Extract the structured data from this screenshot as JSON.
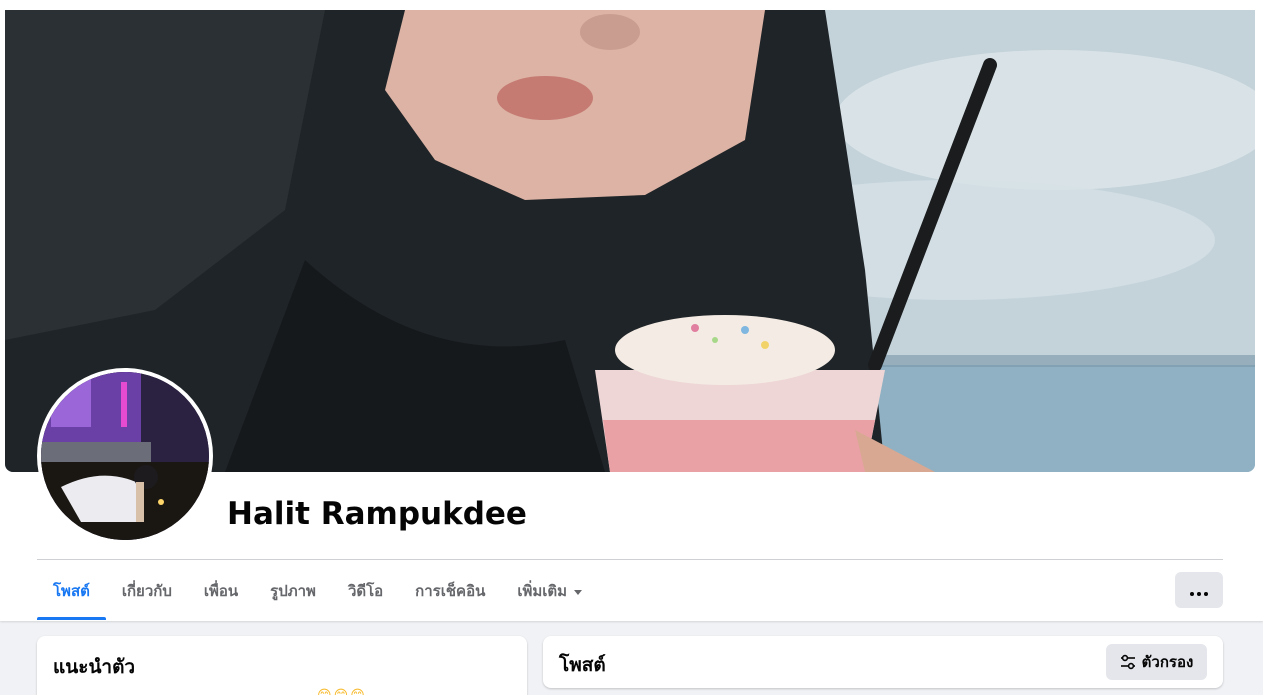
{
  "profile": {
    "name": "Halit Rampukdee"
  },
  "nav": {
    "tabs": [
      {
        "label": "โพสต์",
        "active": true
      },
      {
        "label": "เกี่ยวกับ",
        "active": false
      },
      {
        "label": "เพื่อน",
        "active": false
      },
      {
        "label": "รูปภาพ",
        "active": false
      },
      {
        "label": "วิดีโอ",
        "active": false
      },
      {
        "label": "การเช็คอิน",
        "active": false
      },
      {
        "label": "เพิ่มเติม",
        "active": false
      }
    ],
    "more_icon": "ellipsis-icon"
  },
  "intro": {
    "title": "แนะนำตัว",
    "emoji": "😊😊😊"
  },
  "posts": {
    "title": "โพสต์",
    "filter_label": "ตัวกรอง",
    "filter_icon": "sliders-icon"
  },
  "colors": {
    "accent": "#1877f2",
    "button_bg": "#e4e6eb",
    "page_bg": "#f0f2f5"
  }
}
